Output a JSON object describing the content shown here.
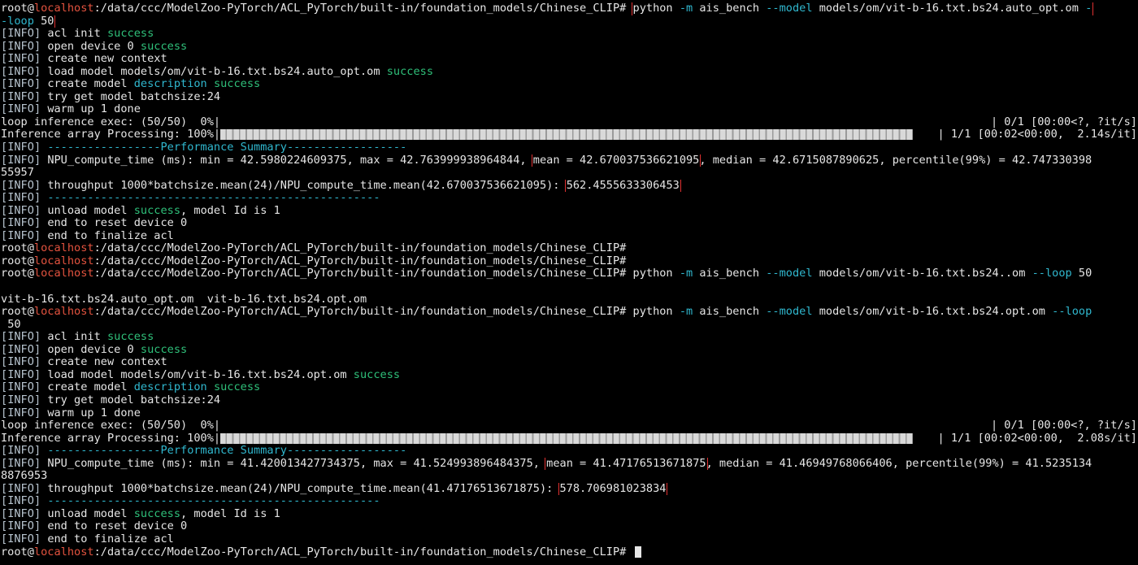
{
  "prompt": {
    "user": "root@",
    "host": "localhost",
    "path": ":/data/ccc/ModelZoo-PyTorch/ACL_PyTorch/built-in/foundation_models/Chinese_CLIP#"
  },
  "tag": {
    "open": "[",
    "label": "INFO",
    "close": "]"
  },
  "colors": {
    "background": "#000000",
    "text": "#e6e6e6",
    "hostname": "#e4533f",
    "success": "#2fc07a",
    "flag": "#30b8cf",
    "box": "#e03030"
  },
  "run1": {
    "cmd_python": "python",
    "flag_m": "-m",
    "cmd_module": "ais_bench",
    "flag_model": "--model",
    "model_path": "models/om/vit-b-16.txt.bs24.auto_opt.om",
    "flag_loop_part1": "-",
    "flag_loop_part2": "-loop",
    "loop_value": "50",
    "acl_init": "acl init",
    "open_device": "open device 0",
    "create_context": "create new context",
    "load_model": "load model models/om/vit-b-16.txt.bs24.auto_opt.om",
    "create_model": "create model",
    "description": "description",
    "success": "success",
    "batchsize": "try get model batchsize:24",
    "warm_up": "warm up 1 done",
    "loop_label": "loop inference exec: (50/50)  0%|",
    "loop_right": "| 0/1 [00:00<?, ?it/s]",
    "infer_label": "Inference array Processing: 100%|",
    "infer_right": "| 1/1 [00:02<00:00,  2.14s/it]",
    "perf_dashes_left": "-----------------",
    "perf_title": "Performance Summary",
    "perf_dashes_right": "------------------",
    "npu_prefix": "NPU_compute_time (ms): min = 42.5980224609375, max = 42.763999938964844,",
    "npu_mean": "mean = 42.670037536621095",
    "npu_suffix": ", median = 42.6715087890625, percentile(99%) = 42.747330398",
    "npu_wrap": "55957",
    "throughput_prefix": "throughput 1000*batchsize.mean(24)/NPU_compute_time.mean(42.670037536621095):",
    "throughput_value": "562.4555633306453",
    "dash_line": "--------------------------------------------------",
    "unload": "unload model",
    "unload_suffix": ", model Id is 1",
    "reset": "end to reset device 0",
    "finalize": "end to finalize acl"
  },
  "run2_attempt": {
    "cmd_python": "python",
    "flag_m": "-m",
    "cmd_module": "ais_bench",
    "flag_model": "--model",
    "model_path": "models/om/vit-b-16.txt.bs24..om",
    "flag_loop": "--loop",
    "loop_value": "50",
    "completions": "vit-b-16.txt.bs24.auto_opt.om  vit-b-16.txt.bs24.opt.om"
  },
  "run3": {
    "cmd_python": "python",
    "flag_m": "-m",
    "cmd_module": "ais_bench",
    "flag_model": "--model",
    "model_path": "models/om/vit-b-16.txt.bs24.opt.om",
    "flag_loop": "--loop",
    "loop_value": "50",
    "acl_init": "acl init",
    "open_device": "open device 0",
    "create_context": "create new context",
    "load_model": "load model models/om/vit-b-16.txt.bs24.opt.om",
    "create_model": "create model",
    "description": "description",
    "success": "success",
    "batchsize": "try get model batchsize:24",
    "warm_up": "warm up 1 done",
    "loop_label": "loop inference exec: (50/50)  0%|",
    "loop_right": "| 0/1 [00:00<?, ?it/s]",
    "infer_label": "Inference array Processing: 100%|",
    "infer_right": "| 1/1 [00:02<00:00,  2.08s/it]",
    "perf_dashes_left": "-----------------",
    "perf_title": "Performance Summary",
    "perf_dashes_right": "------------------",
    "npu_prefix": "NPU_compute_time (ms): min = 41.420013427734375, max = 41.524993896484375,",
    "npu_mean": "mean = 41.47176513671875",
    "npu_suffix": ", median = 41.46949768066406, percentile(99%) = 41.5235134",
    "npu_wrap": "8876953",
    "throughput_prefix": "throughput 1000*batchsize.mean(24)/NPU_compute_time.mean(41.47176513671875):",
    "throughput_value": "578.706981023834",
    "dash_line": "--------------------------------------------------",
    "unload": "unload model",
    "unload_suffix": ", model Id is 1",
    "reset": "end to reset device 0",
    "finalize": "end to finalize acl"
  }
}
